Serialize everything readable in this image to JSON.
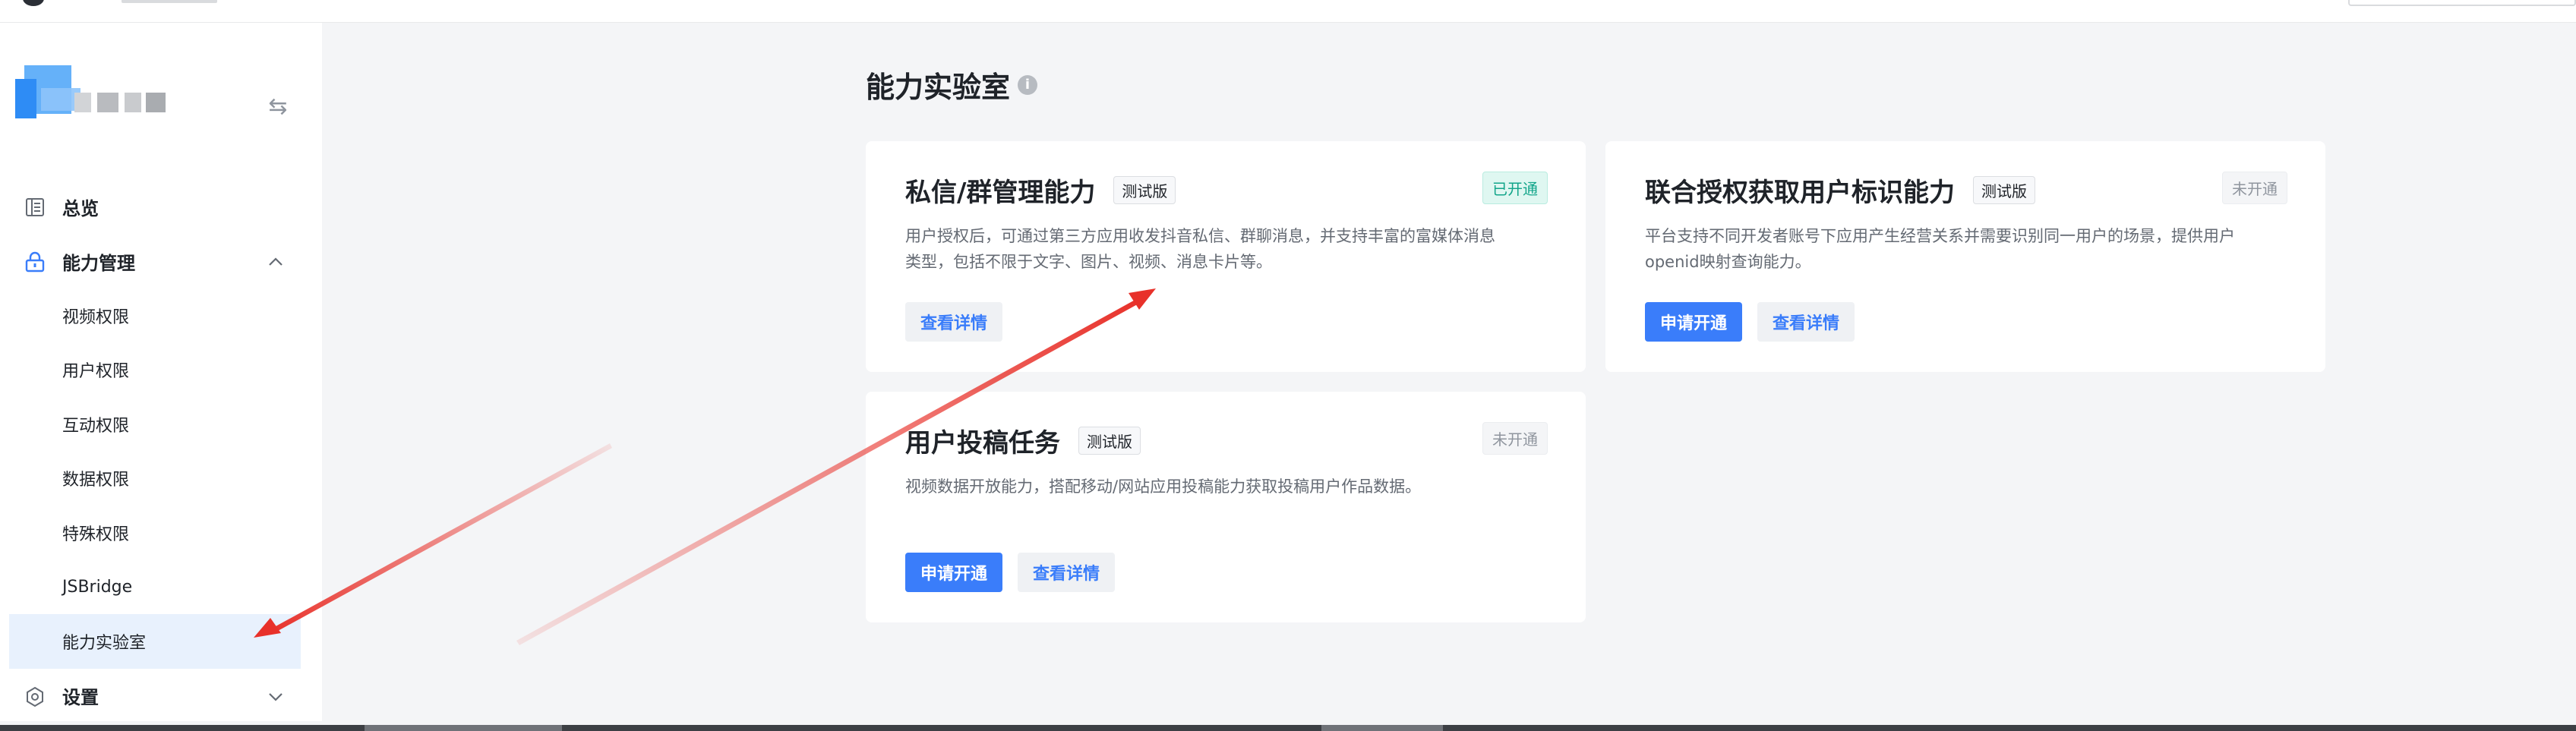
{
  "sidebar": {
    "collapse_icon": "⇆",
    "items": [
      {
        "label": "总览",
        "icon": "overview-icon"
      },
      {
        "label": "能力管理",
        "icon": "lock-icon",
        "expanded": true
      },
      {
        "label": "设置",
        "icon": "gear-icon",
        "expanded": false
      }
    ],
    "sub_items": [
      {
        "label": "视频权限"
      },
      {
        "label": "用户权限"
      },
      {
        "label": "互动权限"
      },
      {
        "label": "数据权限"
      },
      {
        "label": "特殊权限"
      },
      {
        "label": "JSBridge"
      },
      {
        "label": "能力实验室",
        "active": true
      }
    ]
  },
  "main": {
    "title": "能力实验室",
    "info_icon": "i",
    "cards": [
      {
        "title": "私信/群管理能力",
        "tag": "测试版",
        "status": "已开通",
        "desc_line1": "用户授权后，可通过第三方应用收发抖音私信、群聊消息，并支持丰富的富媒体消息",
        "desc_line2": "类型，包括不限于文字、图片、视频、消息卡片等。",
        "detail_label": "查看详情"
      },
      {
        "title": "联合授权获取用户标识能力",
        "tag": "测试版",
        "status": "未开通",
        "desc_line1": "平台支持不同开发者账号下应用产生经营关系并需要识别同一用户的场景，提供用户",
        "desc_line2": "openid映射查询能力。",
        "apply_label": "申请开通",
        "detail_label": "查看详情"
      },
      {
        "title": "用户投稿任务",
        "tag": "测试版",
        "status": "未开通",
        "desc_line1": "视频数据开放能力，搭配移动/网站应用投稿能力获取投稿用户作品数据。",
        "apply_label": "申请开通",
        "detail_label": "查看详情"
      }
    ]
  },
  "colors": {
    "accent": "#3a7dfa",
    "status_on": "#12a58a",
    "arrow": "#e8312a"
  }
}
